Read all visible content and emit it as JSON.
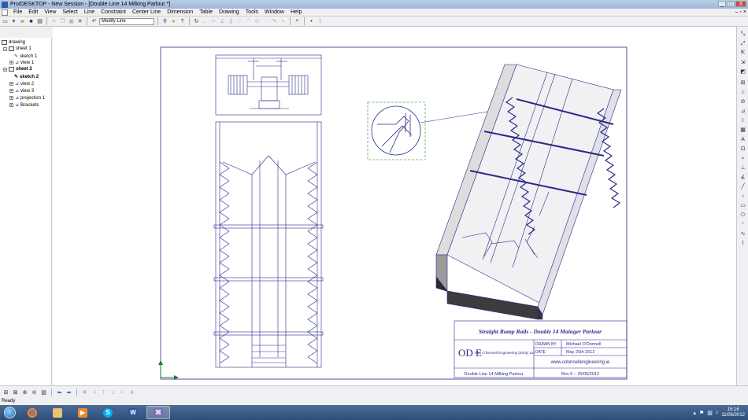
{
  "window": {
    "title": "Pro/DESKTOP - New Session - [Double Line 14 Milking Parlour *]",
    "controls": [
      "_",
      "□",
      "X"
    ]
  },
  "menu": [
    "File",
    "Edit",
    "View",
    "Select",
    "Line",
    "Constraint",
    "Center Line",
    "Dimension",
    "Table",
    "Drawing",
    "Tools",
    "Window",
    "Help"
  ],
  "toolbar": {
    "modify_select": "Modify Line"
  },
  "tree": {
    "root": "drawing",
    "items": [
      {
        "label": "sheet 1"
      },
      {
        "label": "sketch 1"
      },
      {
        "label": "view 1"
      },
      {
        "label": "sheet 2"
      },
      {
        "label": "sketch 2"
      },
      {
        "label": "view 2"
      },
      {
        "label": "view 3"
      },
      {
        "label": "projection 1"
      },
      {
        "label": "Brackets"
      }
    ]
  },
  "titleblock": {
    "title": "Straight Rump Rails - Double 14 Mainger Parlour",
    "company": "Wm O'Donnell Engineering (Emly) Ltd",
    "drawn_by_label": "DRAWN BY",
    "drawn_by": "Michael O'Donnell",
    "date_label": "DATE",
    "date": "May 25th 2012",
    "website": "www.odonnellengineering.ie",
    "drawing_name": "Double Line 14 Milking Parlour",
    "revision": "Rev 0  –  25/05/2012",
    "logo": "OD E"
  },
  "status": "Ready",
  "taskbar": {
    "time": "15:16",
    "date": "11/06/2012"
  },
  "colors": {
    "drawing_line": "#2b2b8a",
    "titlebar": "#9db7da",
    "taskbar": "#2f4e7a",
    "detail_box": "#4caf50"
  }
}
